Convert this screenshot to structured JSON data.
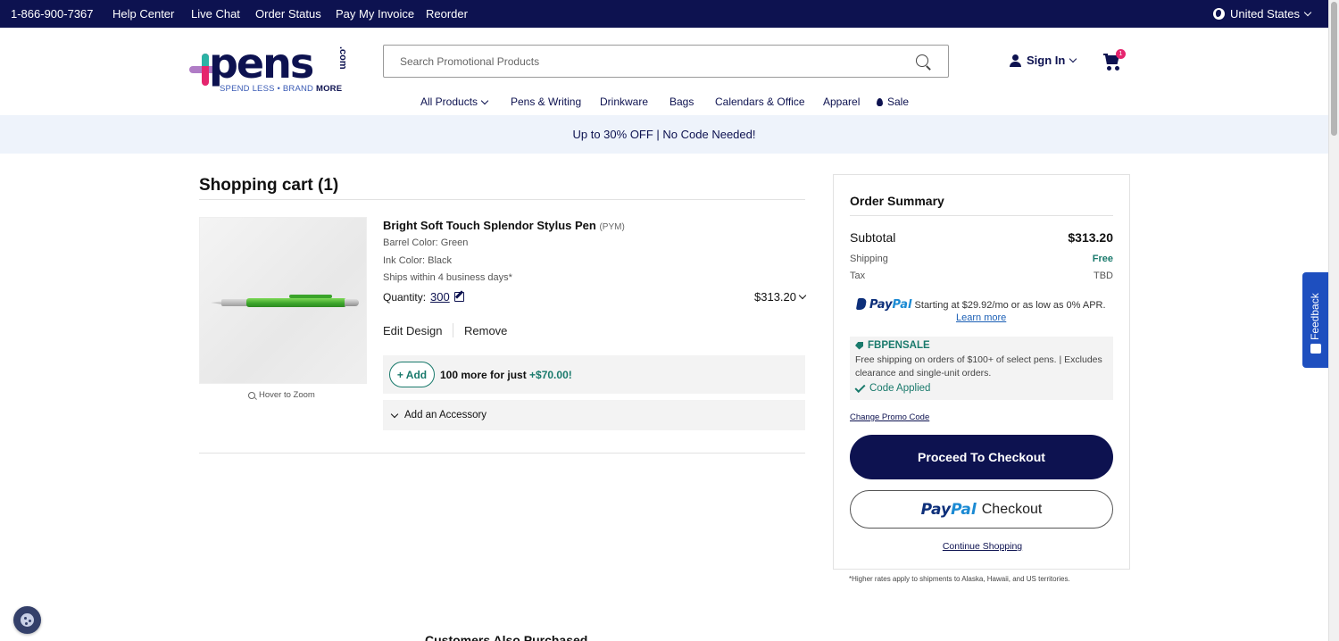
{
  "topbar": {
    "phone": "1-866-900-7367",
    "links": [
      "Help Center",
      "Live Chat",
      "Order Status",
      "Pay My Invoice",
      "Reorder"
    ],
    "region": "United States"
  },
  "header": {
    "logo_word": "pens",
    "logo_com": ".com",
    "logo_tag_a": "SPEND LESS • BRAND ",
    "logo_tag_b": "MORE",
    "search_placeholder": "Search Promotional Products",
    "sign_in": "Sign In",
    "cart_count": "1",
    "search_icon": "search-icon",
    "cart_icon": "cart-icon"
  },
  "nav": [
    "All Products",
    "Pens & Writing",
    "Drinkware",
    "Bags",
    "Calendars & Office",
    "Apparel",
    "Sale"
  ],
  "promo_banner": "Up to 30% OFF | No Code Needed!",
  "cart": {
    "title": "Shopping cart (1)",
    "item": {
      "name": "Bright Soft Touch Splendor Stylus Pen",
      "code": "(PYM)",
      "barrel_color": "Barrel Color: Green",
      "ink_color": "Ink Color: Black",
      "ships": "Ships within 4 business days*",
      "quantity_label": "Quantity:",
      "quantity": "300",
      "price": "$313.20",
      "edit_design": "Edit Design",
      "remove": "Remove",
      "zoom_hint": "Hover to Zoom"
    },
    "upsell": {
      "button": "+ Add",
      "text": "100 more for just ",
      "price": "+$70.00!"
    },
    "accessory": "Add an Accessory",
    "also_purchased": "Customers Also Purchased"
  },
  "summary": {
    "title": "Order Summary",
    "subtotal_label": "Subtotal",
    "subtotal": "$313.20",
    "shipping_label": "Shipping",
    "shipping": "Free",
    "tax_label": "Tax",
    "tax": "TBD",
    "paypal_pay": "Pay",
    "paypal_pal": "Pal",
    "paypal_msg": "Starting at $29.92/mo or as low as 0% APR.",
    "learn_more": "Learn more",
    "promo_code": "FBPENSALE",
    "promo_desc": "Free shipping on orders of $100+ of select pens. | Excludes clearance and single-unit orders.",
    "promo_applied": "Code Applied",
    "change_promo": "Change Promo Code",
    "checkout": "Proceed To Checkout",
    "paypal_checkout": "Checkout",
    "continue": "Continue Shopping",
    "footnote": "*Higher rates apply to shipments to Alaska, Hawaii, and US territories."
  },
  "feedback": "Feedback",
  "colors": {
    "navy": "#0d1250",
    "teal": "#1a7a6c",
    "pink": "#e5256e",
    "feedback_blue": "#1e4fbf",
    "banner_bg": "#eef3fb"
  }
}
